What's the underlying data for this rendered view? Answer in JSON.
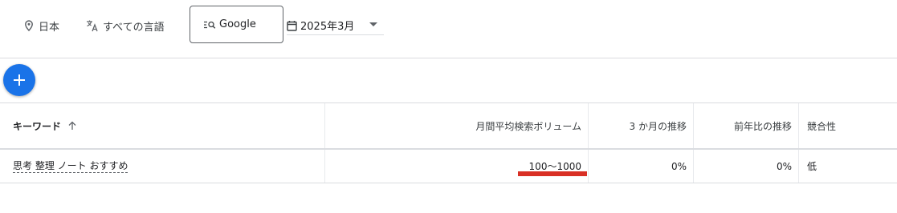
{
  "filters": {
    "location": "日本",
    "language": "すべての言語",
    "engine": "Google",
    "date": "2025年3月"
  },
  "table": {
    "headers": {
      "keyword": "キーワード",
      "volume": "月間平均検索ボリューム",
      "trend3m": "3 か月の推移",
      "yoy": "前年比の推移",
      "competition": "競合性"
    },
    "rows": [
      {
        "keyword": "思考 整理 ノート おすすめ",
        "volume": "100～1000",
        "trend3m": "0%",
        "yoy": "0%",
        "competition": "低"
      }
    ]
  },
  "colors": {
    "accent": "#1a73e8",
    "highlight": "#d93025"
  }
}
